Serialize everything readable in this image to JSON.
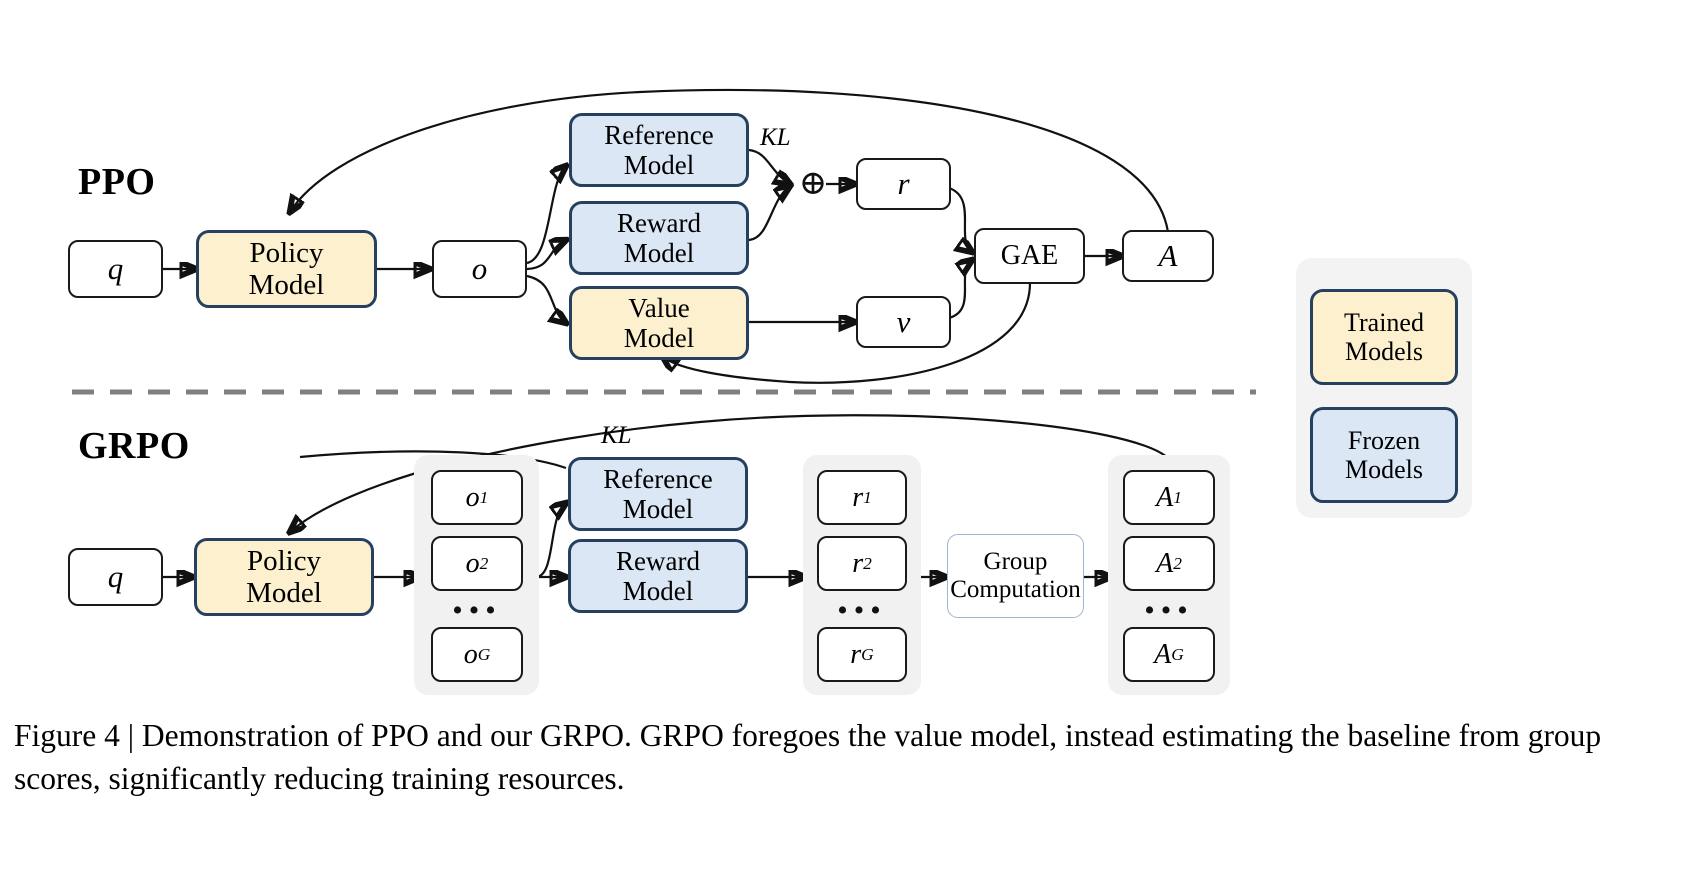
{
  "figure": {
    "caption": "Figure 4 | Demonstration of PPO and our GRPO. GRPO foregoes the value model, instead estimating the baseline from group scores, significantly reducing training resources."
  },
  "ppo": {
    "title": "PPO",
    "q": "q",
    "policy_model": "Policy Model",
    "policy_model_l1": "Policy",
    "policy_model_l2": "Model",
    "o": "o",
    "reference_model_l1": "Reference",
    "reference_model_l2": "Model",
    "reward_model_l1": "Reward",
    "reward_model_l2": "Model",
    "value_model_l1": "Value",
    "value_model_l2": "Model",
    "kl_label": "KL",
    "plus_symbol": "⊕",
    "r": "r",
    "v": "v",
    "gae": "GAE",
    "a": "A"
  },
  "grpo": {
    "title": "GRPO",
    "q": "q",
    "policy_model_l1": "Policy",
    "policy_model_l2": "Model",
    "kl_label": "KL",
    "reference_model_l1": "Reference",
    "reference_model_l2": "Model",
    "reward_model_l1": "Reward",
    "reward_model_l2": "Model",
    "group_computation_l1": "Group",
    "group_computation_l2": "Computation",
    "outputs": {
      "base": "o",
      "items": [
        "1",
        "2",
        "G"
      ],
      "ellipsis": "•••"
    },
    "rewards": {
      "base": "r",
      "items": [
        "1",
        "2",
        "G"
      ],
      "ellipsis": "•••"
    },
    "advantages": {
      "base": "A",
      "items": [
        "1",
        "2",
        "G"
      ],
      "ellipsis": "•••"
    }
  },
  "legend": {
    "trained_l1": "Trained",
    "trained_l2": "Models",
    "frozen_l1": "Frozen",
    "frozen_l2": "Models"
  },
  "colors": {
    "trained_fill": "#fdf0ce",
    "frozen_fill": "#dbe7f5",
    "model_border": "#25415f",
    "group_fill": "#f1f1f1",
    "legend_fill": "#f3f3f3",
    "divider": "#808080",
    "stroke": "#111111"
  }
}
